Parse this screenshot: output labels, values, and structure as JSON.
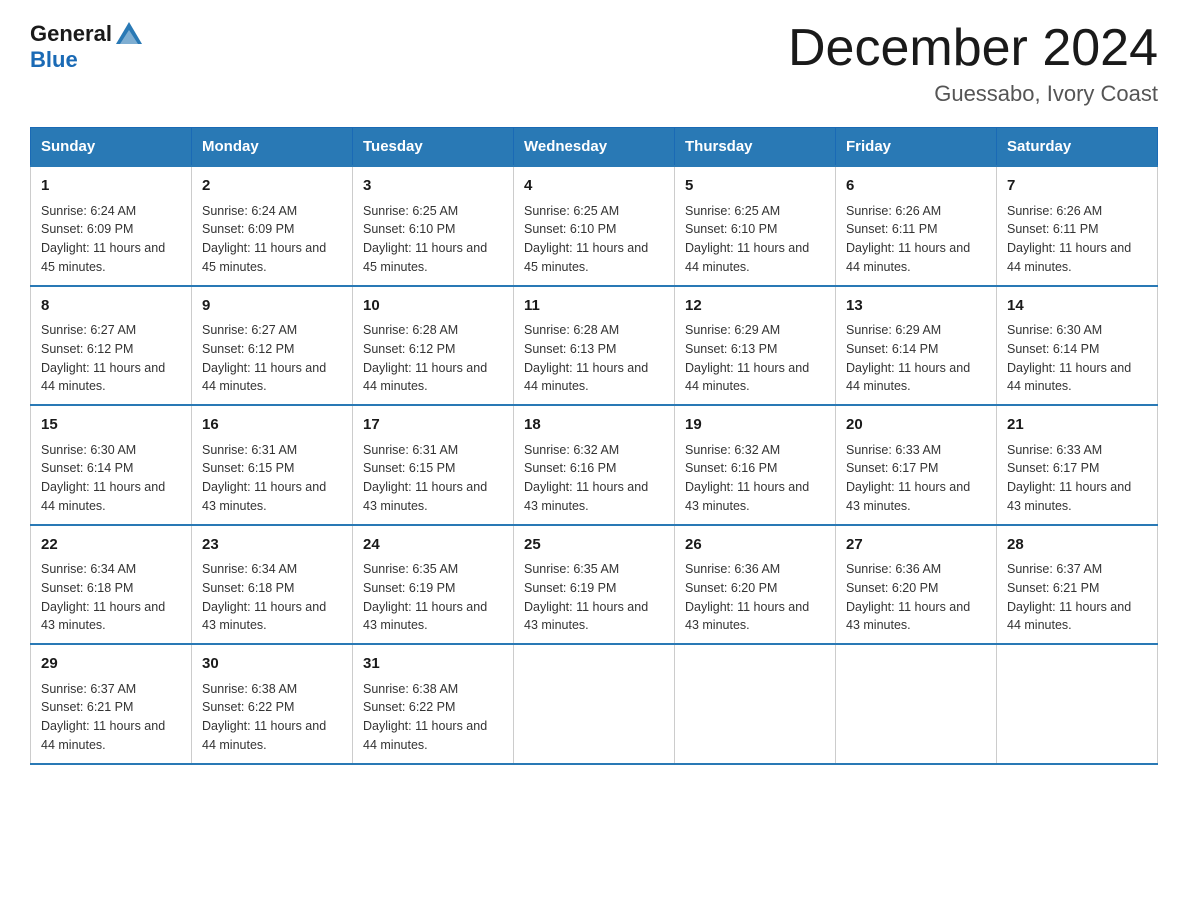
{
  "logo": {
    "text_general": "General",
    "text_blue": "Blue"
  },
  "title": "December 2024",
  "location": "Guessabo, Ivory Coast",
  "days_of_week": [
    "Sunday",
    "Monday",
    "Tuesday",
    "Wednesday",
    "Thursday",
    "Friday",
    "Saturday"
  ],
  "weeks": [
    [
      {
        "day": "1",
        "sunrise": "Sunrise: 6:24 AM",
        "sunset": "Sunset: 6:09 PM",
        "daylight": "Daylight: 11 hours and 45 minutes."
      },
      {
        "day": "2",
        "sunrise": "Sunrise: 6:24 AM",
        "sunset": "Sunset: 6:09 PM",
        "daylight": "Daylight: 11 hours and 45 minutes."
      },
      {
        "day": "3",
        "sunrise": "Sunrise: 6:25 AM",
        "sunset": "Sunset: 6:10 PM",
        "daylight": "Daylight: 11 hours and 45 minutes."
      },
      {
        "day": "4",
        "sunrise": "Sunrise: 6:25 AM",
        "sunset": "Sunset: 6:10 PM",
        "daylight": "Daylight: 11 hours and 45 minutes."
      },
      {
        "day": "5",
        "sunrise": "Sunrise: 6:25 AM",
        "sunset": "Sunset: 6:10 PM",
        "daylight": "Daylight: 11 hours and 44 minutes."
      },
      {
        "day": "6",
        "sunrise": "Sunrise: 6:26 AM",
        "sunset": "Sunset: 6:11 PM",
        "daylight": "Daylight: 11 hours and 44 minutes."
      },
      {
        "day": "7",
        "sunrise": "Sunrise: 6:26 AM",
        "sunset": "Sunset: 6:11 PM",
        "daylight": "Daylight: 11 hours and 44 minutes."
      }
    ],
    [
      {
        "day": "8",
        "sunrise": "Sunrise: 6:27 AM",
        "sunset": "Sunset: 6:12 PM",
        "daylight": "Daylight: 11 hours and 44 minutes."
      },
      {
        "day": "9",
        "sunrise": "Sunrise: 6:27 AM",
        "sunset": "Sunset: 6:12 PM",
        "daylight": "Daylight: 11 hours and 44 minutes."
      },
      {
        "day": "10",
        "sunrise": "Sunrise: 6:28 AM",
        "sunset": "Sunset: 6:12 PM",
        "daylight": "Daylight: 11 hours and 44 minutes."
      },
      {
        "day": "11",
        "sunrise": "Sunrise: 6:28 AM",
        "sunset": "Sunset: 6:13 PM",
        "daylight": "Daylight: 11 hours and 44 minutes."
      },
      {
        "day": "12",
        "sunrise": "Sunrise: 6:29 AM",
        "sunset": "Sunset: 6:13 PM",
        "daylight": "Daylight: 11 hours and 44 minutes."
      },
      {
        "day": "13",
        "sunrise": "Sunrise: 6:29 AM",
        "sunset": "Sunset: 6:14 PM",
        "daylight": "Daylight: 11 hours and 44 minutes."
      },
      {
        "day": "14",
        "sunrise": "Sunrise: 6:30 AM",
        "sunset": "Sunset: 6:14 PM",
        "daylight": "Daylight: 11 hours and 44 minutes."
      }
    ],
    [
      {
        "day": "15",
        "sunrise": "Sunrise: 6:30 AM",
        "sunset": "Sunset: 6:14 PM",
        "daylight": "Daylight: 11 hours and 44 minutes."
      },
      {
        "day": "16",
        "sunrise": "Sunrise: 6:31 AM",
        "sunset": "Sunset: 6:15 PM",
        "daylight": "Daylight: 11 hours and 43 minutes."
      },
      {
        "day": "17",
        "sunrise": "Sunrise: 6:31 AM",
        "sunset": "Sunset: 6:15 PM",
        "daylight": "Daylight: 11 hours and 43 minutes."
      },
      {
        "day": "18",
        "sunrise": "Sunrise: 6:32 AM",
        "sunset": "Sunset: 6:16 PM",
        "daylight": "Daylight: 11 hours and 43 minutes."
      },
      {
        "day": "19",
        "sunrise": "Sunrise: 6:32 AM",
        "sunset": "Sunset: 6:16 PM",
        "daylight": "Daylight: 11 hours and 43 minutes."
      },
      {
        "day": "20",
        "sunrise": "Sunrise: 6:33 AM",
        "sunset": "Sunset: 6:17 PM",
        "daylight": "Daylight: 11 hours and 43 minutes."
      },
      {
        "day": "21",
        "sunrise": "Sunrise: 6:33 AM",
        "sunset": "Sunset: 6:17 PM",
        "daylight": "Daylight: 11 hours and 43 minutes."
      }
    ],
    [
      {
        "day": "22",
        "sunrise": "Sunrise: 6:34 AM",
        "sunset": "Sunset: 6:18 PM",
        "daylight": "Daylight: 11 hours and 43 minutes."
      },
      {
        "day": "23",
        "sunrise": "Sunrise: 6:34 AM",
        "sunset": "Sunset: 6:18 PM",
        "daylight": "Daylight: 11 hours and 43 minutes."
      },
      {
        "day": "24",
        "sunrise": "Sunrise: 6:35 AM",
        "sunset": "Sunset: 6:19 PM",
        "daylight": "Daylight: 11 hours and 43 minutes."
      },
      {
        "day": "25",
        "sunrise": "Sunrise: 6:35 AM",
        "sunset": "Sunset: 6:19 PM",
        "daylight": "Daylight: 11 hours and 43 minutes."
      },
      {
        "day": "26",
        "sunrise": "Sunrise: 6:36 AM",
        "sunset": "Sunset: 6:20 PM",
        "daylight": "Daylight: 11 hours and 43 minutes."
      },
      {
        "day": "27",
        "sunrise": "Sunrise: 6:36 AM",
        "sunset": "Sunset: 6:20 PM",
        "daylight": "Daylight: 11 hours and 43 minutes."
      },
      {
        "day": "28",
        "sunrise": "Sunrise: 6:37 AM",
        "sunset": "Sunset: 6:21 PM",
        "daylight": "Daylight: 11 hours and 44 minutes."
      }
    ],
    [
      {
        "day": "29",
        "sunrise": "Sunrise: 6:37 AM",
        "sunset": "Sunset: 6:21 PM",
        "daylight": "Daylight: 11 hours and 44 minutes."
      },
      {
        "day": "30",
        "sunrise": "Sunrise: 6:38 AM",
        "sunset": "Sunset: 6:22 PM",
        "daylight": "Daylight: 11 hours and 44 minutes."
      },
      {
        "day": "31",
        "sunrise": "Sunrise: 6:38 AM",
        "sunset": "Sunset: 6:22 PM",
        "daylight": "Daylight: 11 hours and 44 minutes."
      },
      null,
      null,
      null,
      null
    ]
  ]
}
